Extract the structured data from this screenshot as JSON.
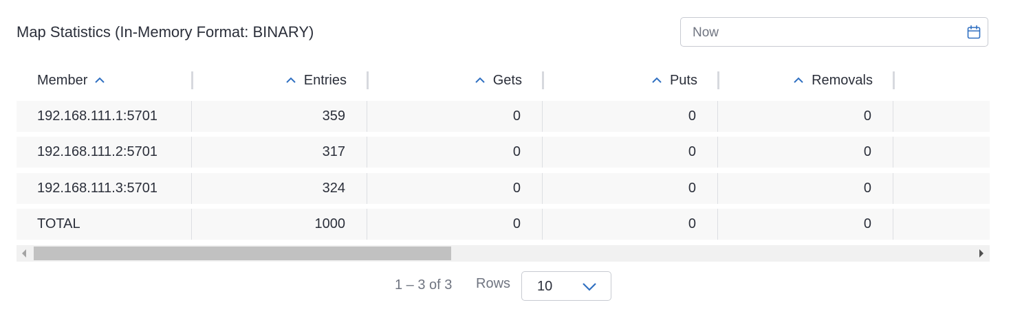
{
  "panel": {
    "title": "Map Statistics (In-Memory Format: BINARY)"
  },
  "date_picker": {
    "value": "Now",
    "icon": "calendar-icon"
  },
  "table": {
    "columns": [
      {
        "label": "Member",
        "sort_icon": "sort-ascending-icon"
      },
      {
        "label": "Entries",
        "sort_icon": "sort-ascending-icon"
      },
      {
        "label": "Gets",
        "sort_icon": "sort-ascending-icon"
      },
      {
        "label": "Puts",
        "sort_icon": "sort-ascending-icon"
      },
      {
        "label": "Removals",
        "sort_icon": "sort-ascending-icon"
      }
    ],
    "rows": [
      {
        "member": "192.168.111.1:5701",
        "entries": "359",
        "gets": "0",
        "puts": "0",
        "removals": "0"
      },
      {
        "member": "192.168.111.2:5701",
        "entries": "317",
        "gets": "0",
        "puts": "0",
        "removals": "0"
      },
      {
        "member": "192.168.111.3:5701",
        "entries": "324",
        "gets": "0",
        "puts": "0",
        "removals": "0"
      },
      {
        "member": "TOTAL",
        "entries": "1000",
        "gets": "0",
        "puts": "0",
        "removals": "0"
      }
    ]
  },
  "pagination": {
    "range_text": "1 – 3 of 3",
    "rows_label": "Rows",
    "rows_per_page": "10"
  },
  "colors": {
    "accent": "#2f6fc1",
    "row_background": "#f8f8f8",
    "scroll_thumb": "#c1c1c1"
  }
}
